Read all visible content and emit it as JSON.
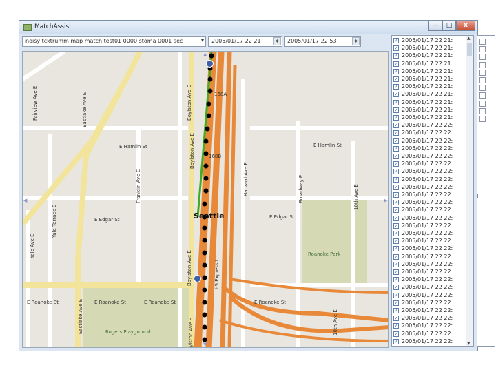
{
  "window": {
    "title": "MatchAssist",
    "btn_min": "–",
    "btn_max": "□",
    "btn_close": "x"
  },
  "toolbar": {
    "file_value": "noisy tcktrumm map match test01 0000 stoma 0001 sec",
    "start_value": "2005/01/17 22 21",
    "end_value": "2005/01/17 22 53"
  },
  "map": {
    "street_labels": {
      "fairview": "Fairview Ave E",
      "eastlake": "Eastlake Ave E",
      "boylston_n": "Boylston Ave E",
      "boylston_s": "Boylston Ave E",
      "boylston_mid": "Boylston Ave E",
      "harvard": "Harvard Ave E",
      "broadway": "Broadway E",
      "tenth": "10th Ave E",
      "tenth_s": "10th Ave E",
      "franklin": "Franklin Ave E",
      "yale_terrace": "Yale Terrace E",
      "yale": "Yale Ave E",
      "eastlake_s": "Eastlake Ave E",
      "i5_express": "I-5 Express Ln",
      "i5_ramp": "I-5 Express Ln",
      "hamlin_w": "E Hamlin St",
      "hamlin_e": "E Hamlin St",
      "edgar_w": "E Edgar St",
      "edgar_e": "E Edgar St",
      "roanoke_1": "E Roanoke St",
      "roanoke_2": "E Roanoke St",
      "roanoke_3": "E Roanoke St",
      "roanoke_4": "E Roanoke St",
      "exit_168a": "168A",
      "exit_168b": "168B"
    },
    "city_label": "Seattle",
    "parks": {
      "roanoke": "Roanoke Park",
      "rogers": "Rogers Playground"
    },
    "pan_arrows": {
      "up": "▲",
      "down": "▼",
      "left": "◀",
      "right": "▶"
    }
  },
  "timestamps": {
    "rows": [
      "2005/01/17 22 21:",
      "2005/01/17 22 21:",
      "2005/01/17 22 21:",
      "2005/01/17 22 21:",
      "2005/01/17 22 21:",
      "2005/01/17 22 21:",
      "2005/01/17 22 21:",
      "2005/01/17 22 21:",
      "2005/01/17 22 21:",
      "2005/01/17 22 21:",
      "2005/01/17 22 21:",
      "2005/01/17 22 22:",
      "2005/01/17 22 22:",
      "2005/01/17 22 22:",
      "2005/01/17 22 22:",
      "2005/01/17 22 22:",
      "2005/01/17 22 22:",
      "2005/01/17 22 22:",
      "2005/01/17 22 22:",
      "2005/01/17 22 22:",
      "2005/01/17 22 22:",
      "2005/01/17 22 22:",
      "2005/01/17 22 22:",
      "2005/01/17 22 22:",
      "2005/01/17 22 22:",
      "2005/01/17 22 22:",
      "2005/01/17 22 22:",
      "2005/01/17 22 22:",
      "2005/01/17 22 22:",
      "2005/01/17 22 22:",
      "2005/01/17 22 22:",
      "2005/01/17 22 22:",
      "2005/01/17 22 22:",
      "2005/01/17 22 22:",
      "2005/01/17 22 22:",
      "2005/01/17 22 22:",
      "2005/01/17 22 22:",
      "2005/01/17 22 22:",
      "2005/01/17 22 22:",
      "2005/01/17 22 22:"
    ],
    "checkmark": "✓"
  },
  "colors": {
    "highway": "#e88a3c",
    "arterial": "#f3e7a0",
    "park": "#d4d9b0",
    "route_line": "#45b02a"
  }
}
